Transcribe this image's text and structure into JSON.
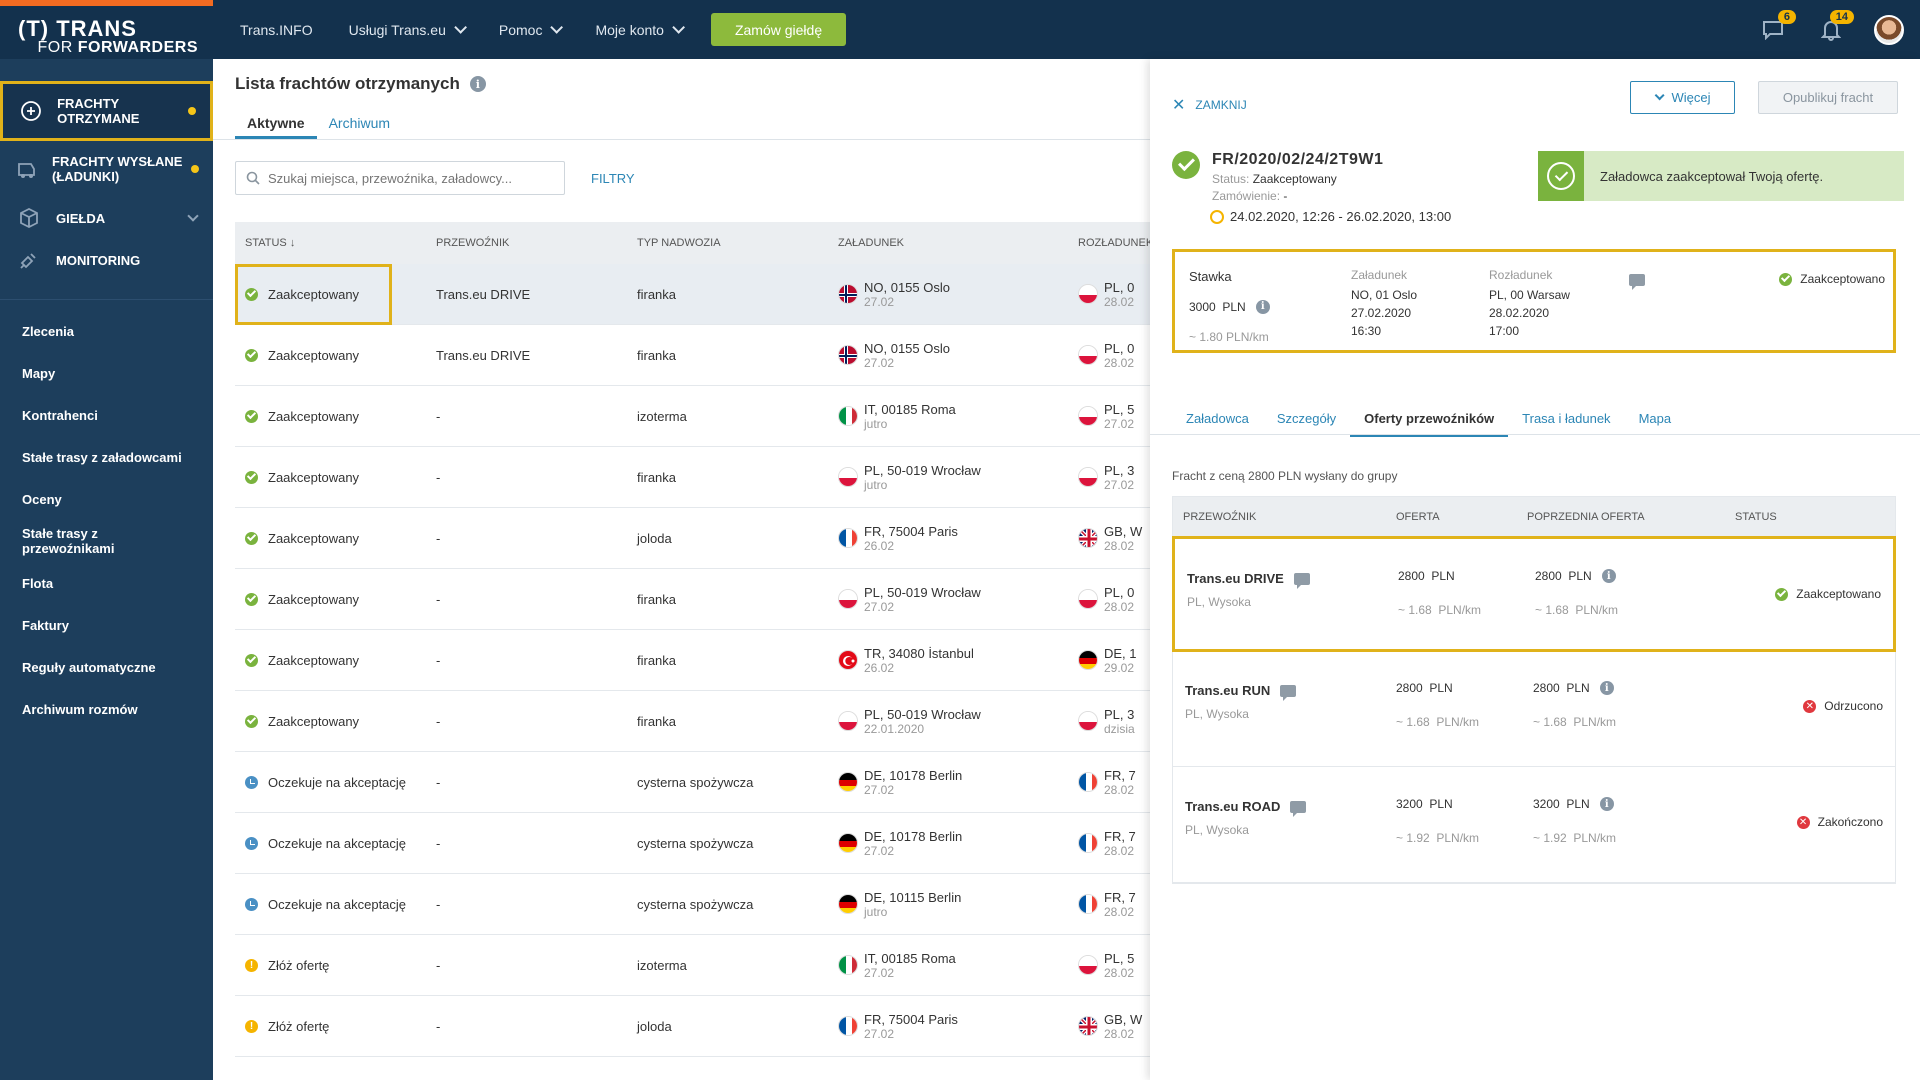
{
  "logo": {
    "line1": "(T) TRANS",
    "line2_prefix": "FOR",
    "line2_main": "FORWARDERS"
  },
  "nav": [
    {
      "label": "Trans.INFO",
      "has_dropdown": false
    },
    {
      "label": "Usługi Trans.eu",
      "has_dropdown": true
    },
    {
      "label": "Pomoc",
      "has_dropdown": true
    },
    {
      "label": "Moje konto",
      "has_dropdown": true
    }
  ],
  "cta_label": "Zamów giełdę",
  "top_icons": {
    "messages_badge": "6",
    "notifications_badge": "14"
  },
  "sidebar": {
    "main": [
      {
        "label": "FRACHTY OTRZYMANE",
        "icon": "freight-received-icon",
        "dot": true,
        "active": true
      },
      {
        "label": "FRACHTY WYSŁANE (ŁADUNKI)",
        "icon": "freight-sent-icon",
        "dot": true,
        "active": false
      },
      {
        "label": "GIEŁDA",
        "icon": "box-icon",
        "dot": false,
        "active": false,
        "dropdown": true
      },
      {
        "label": "MONITORING",
        "icon": "satellite-icon",
        "dot": false,
        "active": false
      }
    ],
    "sub": [
      "Zlecenia",
      "Mapy",
      "Kontrahenci",
      "Stałe trasy z załadowcami",
      "Oceny",
      "Stałe trasy z przewoźnikami",
      "Flota",
      "Faktury",
      "Reguły automatyczne",
      "Archiwum rozmów"
    ]
  },
  "main": {
    "title": "Lista frachtów otrzymanych",
    "tabs": [
      "Aktywne",
      "Archiwum"
    ],
    "search_placeholder": "Szukaj miejsca, przewoźnika, załadowcy...",
    "filters_label": "FILTRY",
    "columns": [
      "STATUS ↓",
      "PRZEWOŹNIK",
      "TYP NADWOZIA",
      "ZAŁADUNEK",
      "ROZŁADUNEK"
    ],
    "rows": [
      {
        "status": "Zaakceptowany",
        "status_type": "ok",
        "carrier": "Trans.eu DRIVE",
        "body": "firanka",
        "load_flag": "NO",
        "load_place": "NO, 0155 Oslo",
        "load_date": "27.02",
        "unload_flag": "PL",
        "unload_place": "PL, 0",
        "unload_date": "28.02"
      },
      {
        "status": "Zaakceptowany",
        "status_type": "ok",
        "carrier": "Trans.eu DRIVE",
        "body": "firanka",
        "load_flag": "NO",
        "load_place": "NO, 0155 Oslo",
        "load_date": "27.02",
        "unload_flag": "PL",
        "unload_place": "PL, 0",
        "unload_date": "28.02"
      },
      {
        "status": "Zaakceptowany",
        "status_type": "ok",
        "carrier": "-",
        "body": "izoterma",
        "load_flag": "IT",
        "load_place": "IT, 00185 Roma",
        "load_date": "jutro",
        "unload_flag": "PL",
        "unload_place": "PL, 5",
        "unload_date": "27.02"
      },
      {
        "status": "Zaakceptowany",
        "status_type": "ok",
        "carrier": "-",
        "body": "firanka",
        "load_flag": "PL",
        "load_place": "PL, 50-019 Wrocław",
        "load_date": "jutro",
        "unload_flag": "PL",
        "unload_place": "PL, 3",
        "unload_date": "27.02"
      },
      {
        "status": "Zaakceptowany",
        "status_type": "ok",
        "carrier": "-",
        "body": "joloda",
        "load_flag": "FR",
        "load_place": "FR, 75004 Paris",
        "load_date": "26.02",
        "unload_flag": "GB",
        "unload_place": "GB, W",
        "unload_date": "28.02"
      },
      {
        "status": "Zaakceptowany",
        "status_type": "ok",
        "carrier": "-",
        "body": "firanka",
        "load_flag": "PL",
        "load_place": "PL, 50-019 Wrocław",
        "load_date": "27.02",
        "unload_flag": "PL",
        "unload_place": "PL, 0",
        "unload_date": "28.02"
      },
      {
        "status": "Zaakceptowany",
        "status_type": "ok",
        "carrier": "-",
        "body": "firanka",
        "load_flag": "TR",
        "load_place": "TR, 34080 İstanbul",
        "load_date": "26.02",
        "unload_flag": "DE",
        "unload_place": "DE, 1",
        "unload_date": "29.02"
      },
      {
        "status": "Zaakceptowany",
        "status_type": "ok",
        "carrier": "-",
        "body": "firanka",
        "load_flag": "PL",
        "load_place": "PL, 50-019 Wrocław",
        "load_date": "22.01.2020",
        "unload_flag": "PL",
        "unload_place": "PL, 3",
        "unload_date": "dzisia"
      },
      {
        "status": "Oczekuje na akceptację",
        "status_type": "wait",
        "carrier": "-",
        "body": "cysterna spożywcza",
        "load_flag": "DE",
        "load_place": "DE, 10178 Berlin",
        "load_date": "27.02",
        "unload_flag": "FR",
        "unload_place": "FR, 7",
        "unload_date": "28.02"
      },
      {
        "status": "Oczekuje na akceptację",
        "status_type": "wait",
        "carrier": "-",
        "body": "cysterna spożywcza",
        "load_flag": "DE",
        "load_place": "DE, 10178 Berlin",
        "load_date": "27.02",
        "unload_flag": "FR",
        "unload_place": "FR, 7",
        "unload_date": "28.02"
      },
      {
        "status": "Oczekuje na akceptację",
        "status_type": "wait",
        "carrier": "-",
        "body": "cysterna spożywcza",
        "load_flag": "DE",
        "load_place": "DE, 10115 Berlin",
        "load_date": "jutro",
        "unload_flag": "FR",
        "unload_place": "FR, 7",
        "unload_date": "28.02"
      },
      {
        "status": "Złóż ofertę",
        "status_type": "warn",
        "carrier": "-",
        "body": "izoterma",
        "load_flag": "IT",
        "load_place": "IT, 00185 Roma",
        "load_date": "27.02",
        "unload_flag": "PL",
        "unload_place": "PL, 5",
        "unload_date": "28.02"
      },
      {
        "status": "Złóż ofertę",
        "status_type": "warn",
        "carrier": "-",
        "body": "joloda",
        "load_flag": "FR",
        "load_place": "FR, 75004 Paris",
        "load_date": "27.02",
        "unload_flag": "GB",
        "unload_place": "GB, W",
        "unload_date": "28.02"
      }
    ]
  },
  "panel": {
    "close_label": "ZAMKNIJ",
    "more_label": "Więcej",
    "publish_label": "Opublikuj fracht",
    "freight_id": "FR/2020/02/24/2T9W1",
    "status_label": "Status:",
    "status_value": "Zaakceptowany",
    "order_label": "Zamówienie:",
    "order_value": "-",
    "date_range": "24.02.2020, 12:26 - 26.02.2020, 13:00",
    "notice": "Załadowca zaakceptował Twoją ofertę.",
    "summary": {
      "rate_label": "Stawka",
      "rate_value": "3000",
      "rate_currency": "PLN",
      "rate_per_km": "~ 1.80 PLN/km",
      "load_label": "Załadunek",
      "load_place": "NO, 01 Oslo",
      "load_date": "27.02.2020",
      "load_time": "16:30",
      "unload_label": "Rozładunek",
      "unload_place": "PL, 00 Warsaw",
      "unload_date": "28.02.2020",
      "unload_time": "17:00",
      "status": "Zaakceptowano"
    },
    "tabs": [
      "Załadowca",
      "Szczegóły",
      "Oferty przewoźników",
      "Trasa i ładunek",
      "Mapa"
    ],
    "active_tab": 2,
    "offer_note": "Fracht z ceną 2800 PLN wysłany do grupy",
    "offer_columns": [
      "PRZEWOŹNIK",
      "OFERTA",
      "POPRZEDNIA OFERTA",
      "STATUS"
    ],
    "offers": [
      {
        "carrier": "Trans.eu DRIVE",
        "location": "PL, Wysoka",
        "offer": "2800  PLN",
        "offer_km": "~ 1.68  PLN/km",
        "prev": "2800  PLN",
        "prev_km": "~ 1.68  PLN/km",
        "status": "Zaakceptowano",
        "status_type": "ok"
      },
      {
        "carrier": "Trans.eu RUN",
        "location": "PL, Wysoka",
        "offer": "2800  PLN",
        "offer_km": "~ 1.68  PLN/km",
        "prev": "2800  PLN",
        "prev_km": "~ 1.68  PLN/km",
        "status": "Odrzucono",
        "status_type": "x"
      },
      {
        "carrier": "Trans.eu ROAD",
        "location": "PL, Wysoka",
        "offer": "3200  PLN",
        "offer_km": "~ 1.92  PLN/km",
        "prev": "3200  PLN",
        "prev_km": "~ 1.92  PLN/km",
        "status": "Zakończono",
        "status_type": "x"
      }
    ]
  },
  "colors": {
    "topbar": "#13314d",
    "sidebar": "#1d3e5c",
    "accent": "#2c86b5",
    "cta": "#8dba3c",
    "highlight": "#e0b21a",
    "ok": "#7ab33e",
    "error": "#e0383e"
  }
}
